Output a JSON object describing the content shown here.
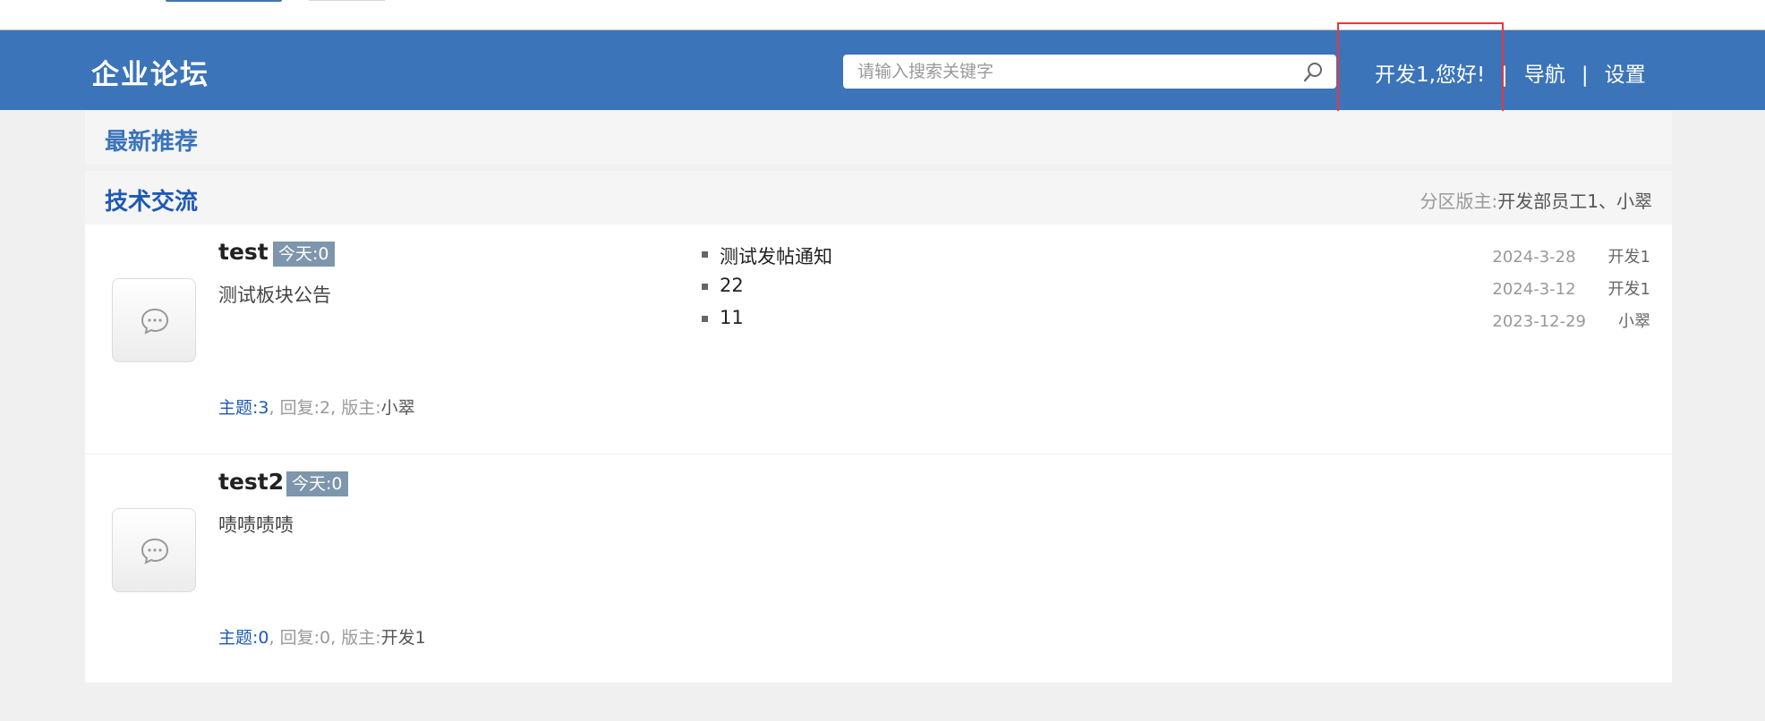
{
  "header": {
    "logo": "企业论坛",
    "search_placeholder": "请输入搜索关键字",
    "greeting": "开发1,您好!",
    "separator": "|",
    "nav_label": "导航",
    "settings_label": "设置",
    "colors": {
      "bar": "#3b74b9",
      "annotation": "#e8383d"
    }
  },
  "recommend": {
    "title": "最新推荐"
  },
  "category": {
    "title": "技术交流",
    "moderators_label": "分区版主:",
    "moderators": "开发部员工1、小翠"
  },
  "forums": [
    {
      "name": "test",
      "today": "今天:0",
      "description": "测试板块公告",
      "stats": {
        "topics_label": "主题:",
        "topics": "3",
        "replies_label": "回复:",
        "replies": "2",
        "moderator_label": "版主:",
        "moderator": "小翠"
      },
      "posts": [
        {
          "title": "测试发帖通知",
          "date": "2024-3-28",
          "author": "开发1"
        },
        {
          "title": "22",
          "date": "2024-3-12",
          "author": "开发1"
        },
        {
          "title": "11",
          "date": "2023-12-29",
          "author": "小翠"
        }
      ]
    },
    {
      "name": "test2",
      "today": "今天:0",
      "description": "啧啧啧啧",
      "stats": {
        "topics_label": "主题:",
        "topics": "0",
        "replies_label": "回复:",
        "replies": "0",
        "moderator_label": "版主:",
        "moderator": "开发1"
      },
      "posts": []
    }
  ]
}
